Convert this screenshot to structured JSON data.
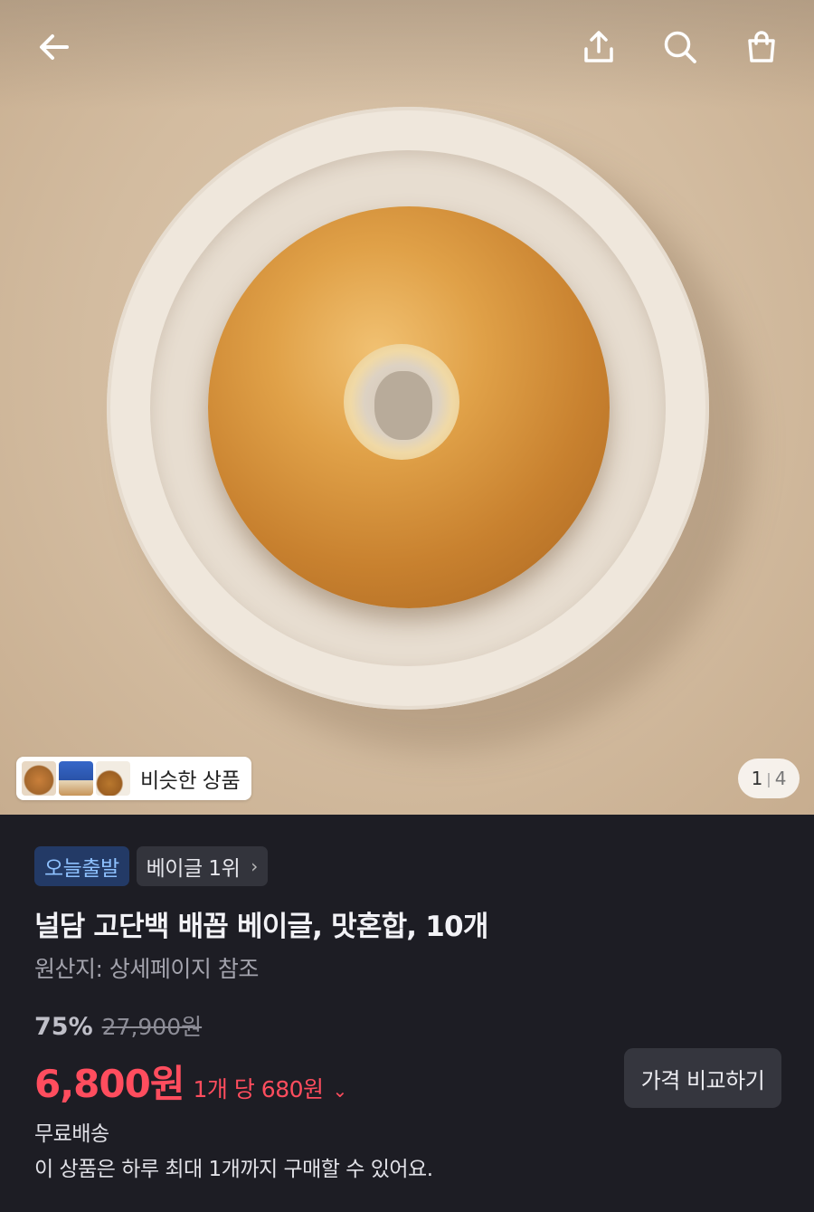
{
  "header": {
    "back_icon": "arrow-left-icon",
    "share_icon": "share-icon",
    "search_icon": "search-icon",
    "cart_icon": "shopping-bag-icon"
  },
  "gallery": {
    "similar_label": "비슷한 상품",
    "page_current": "1",
    "page_total": "4"
  },
  "badges": {
    "today_label": "오늘출발",
    "rank_label": "베이글 1위",
    "rank_chevron": "›"
  },
  "product": {
    "title": "널담 고단백 배꼽 베이글, 맛혼합, 10개",
    "origin": "원산지: 상세페이지 참조"
  },
  "pricing": {
    "discount_rate": "75%",
    "original_price": "27,900원",
    "price": "6,800원",
    "unit_price": "1개 당 680원",
    "unit_chevron": "⌄",
    "compare_button": "가격 비교하기"
  },
  "delivery": {
    "shipping": "무료배송",
    "purchase_limit": "이 상품은 하루 최대 1개까지 구매할 수 있어요."
  },
  "colors": {
    "accent_price": "#ff4d5e",
    "today_badge_bg": "#233a66",
    "today_badge_text": "#8ec1ff",
    "background": "#1d1d24"
  }
}
